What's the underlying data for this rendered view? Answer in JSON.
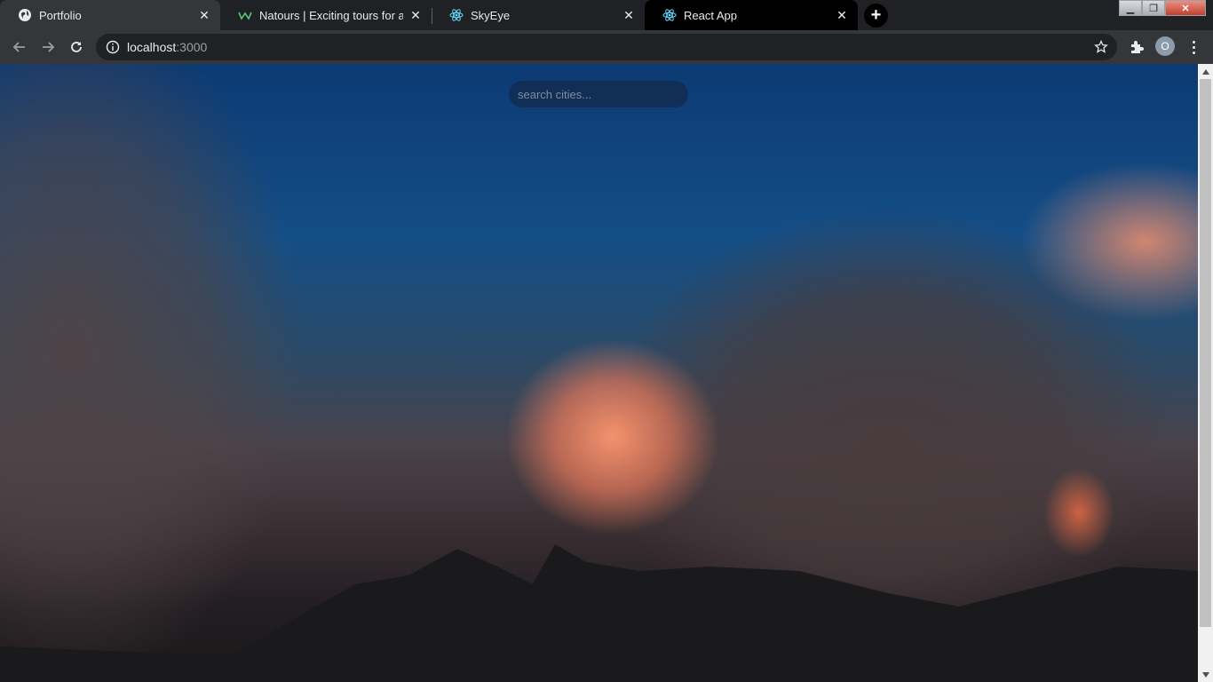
{
  "tabs": [
    {
      "title": "Portfolio",
      "icon": "globe-icon",
      "active": true
    },
    {
      "title": "Natours | Exciting tours for adventurous people",
      "icon": "natours-logo-icon",
      "active": false
    },
    {
      "title": "SkyEye",
      "icon": "react-icon",
      "active": false
    },
    {
      "title": "React App",
      "icon": "react-icon",
      "active": true
    }
  ],
  "address_bar": {
    "host": "localhost",
    "port": ":3000"
  },
  "profile_initial": "O",
  "search": {
    "placeholder": "search cities...",
    "value": ""
  },
  "colors": {
    "sky_top": "#0c3a73",
    "cloud_glow": "#ff966e",
    "chrome_bg": "#202124",
    "toolbar_bg": "#35363a"
  }
}
